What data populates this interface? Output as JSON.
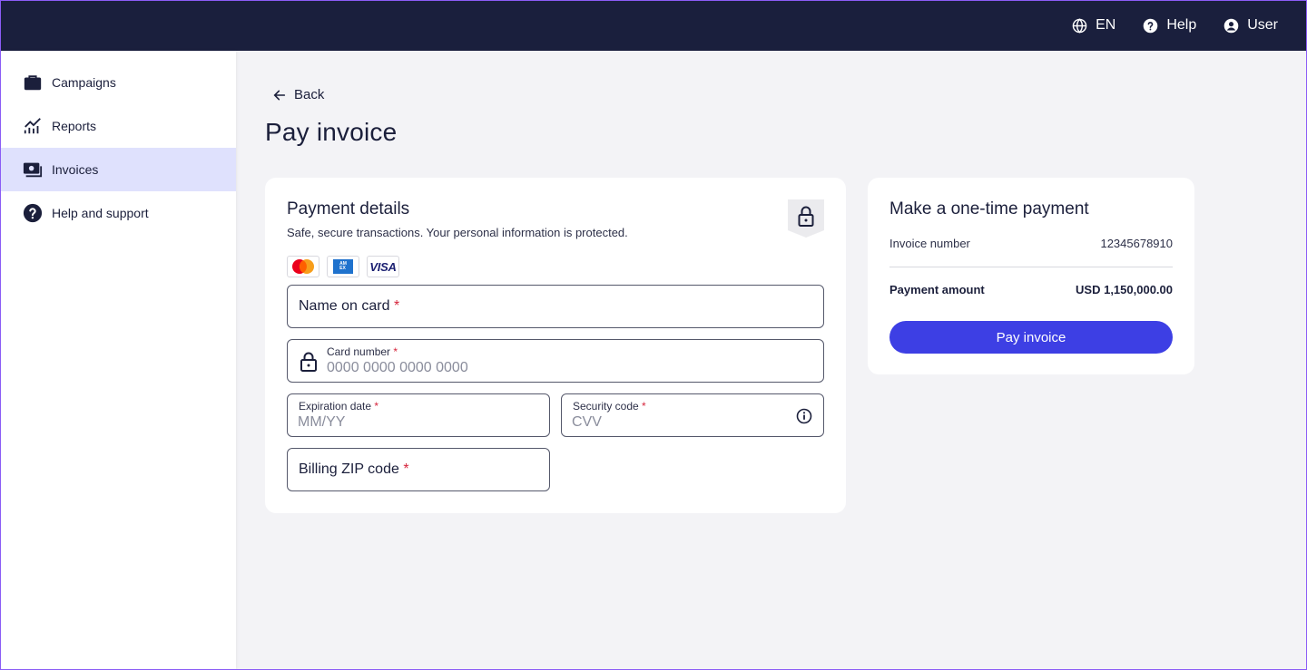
{
  "topbar": {
    "language": "EN",
    "help": "Help",
    "user": "User"
  },
  "sidebar": {
    "items": [
      {
        "label": "Campaigns",
        "icon": "briefcase-icon"
      },
      {
        "label": "Reports",
        "icon": "chart-icon"
      },
      {
        "label": "Invoices",
        "icon": "cash-icon",
        "active": true
      },
      {
        "label": "Help and support",
        "icon": "question-circle-icon"
      }
    ]
  },
  "main": {
    "back_label": "Back",
    "title": "Pay invoice"
  },
  "payment": {
    "title": "Payment details",
    "subtitle": "Safe, secure transactions. Your personal information is protected.",
    "card_brands": [
      "mastercard",
      "amex",
      "VISA"
    ],
    "name_label": "Name on card",
    "card_number_label": "Card number",
    "card_number_placeholder": "0000 0000 0000 0000",
    "expiration_label": "Expiration date",
    "expiration_placeholder": "MM/YY",
    "security_label": "Security code",
    "security_placeholder": "CVV",
    "zip_label": "Billing ZIP code",
    "required_mark": "*"
  },
  "summary": {
    "title": "Make a one-time payment",
    "invoice_number_label": "Invoice number",
    "invoice_number_value": "12345678910",
    "amount_label": "Payment amount",
    "amount_value": "USD 1,150,000.00",
    "pay_button": "Pay invoice"
  },
  "colors": {
    "topbar": "#1a1f3d",
    "accent": "#3d3fe4",
    "active_nav": "#dfe1fd",
    "required": "#d6263d"
  }
}
